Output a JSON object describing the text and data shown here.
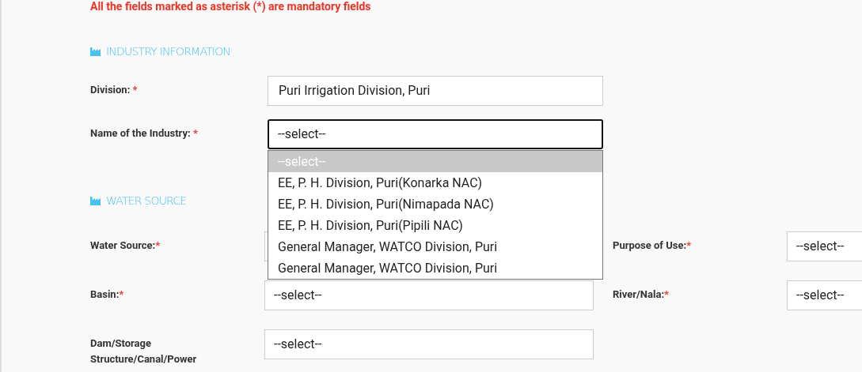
{
  "notice": "All the fields marked as asterisk (*) are mandatory fields",
  "industry_section": {
    "title": "INDUSTRY INFORMATION",
    "fields": [
      {
        "label": "Division: ",
        "mark": "*",
        "kind": "input",
        "value": "Puri Irrigation Division, Puri",
        "focused": false
      },
      {
        "label": "Name of the Industry: ",
        "mark": "*",
        "kind": "select",
        "value": "--select--",
        "focused": true,
        "options": [
          {
            "label": "--select--",
            "selected": true
          },
          {
            "label": "EE, P. H. Division, Puri(Konarka NAC)",
            "selected": false
          },
          {
            "label": "EE, P. H. Division, Puri(Nimapada NAC)",
            "selected": false
          },
          {
            "label": "EE, P. H. Division, Puri(Pipili NAC)",
            "selected": false
          },
          {
            "label": "General Manager, WATCO Division, Puri",
            "selected": false
          },
          {
            "label": "General Manager, WATCO Division, Puri",
            "selected": false
          }
        ]
      }
    ]
  },
  "water_section": {
    "title": "WATER SOURCE",
    "rows": [
      [
        {
          "label": "Water Source:",
          "mark": "*",
          "kind": "select"
        },
        {
          "label": "Purpose of Use:",
          "mark": "*",
          "kind": "select",
          "value": "--select--"
        }
      ],
      [
        {
          "label": "Basin:",
          "mark": "*",
          "kind": "select",
          "value": "--select--"
        },
        {
          "label": "River/Nala:",
          "mark": "*",
          "kind": "select",
          "value": "--select--"
        }
      ],
      [
        {
          "label": "Dam/Storage Structure/Canal/Power",
          "kind": "select",
          "value": "--select--"
        }
      ]
    ]
  }
}
